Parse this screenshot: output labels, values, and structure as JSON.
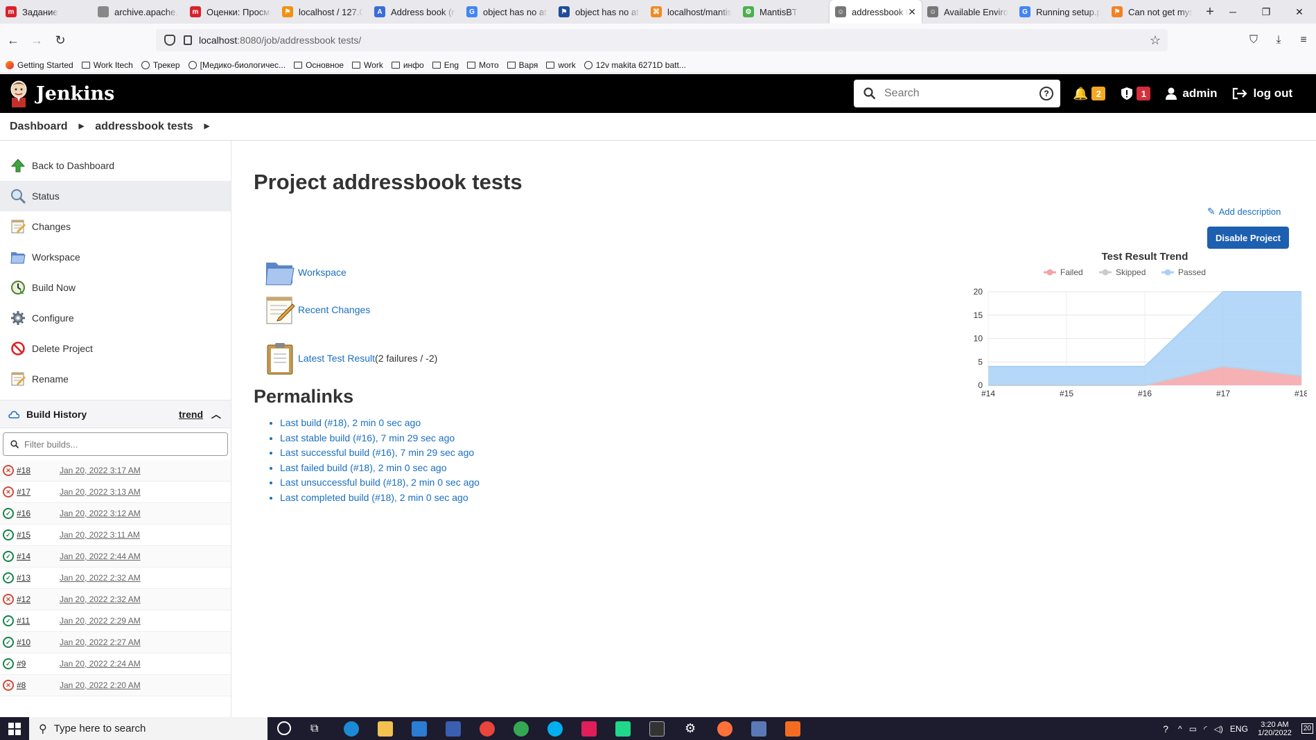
{
  "browser": {
    "tabs": [
      {
        "title": "Задание",
        "color": "#d7222b",
        "glyph": "m"
      },
      {
        "title": "archive.apache.org/c",
        "color": "#888",
        "glyph": ""
      },
      {
        "title": "Оценки: Просмо",
        "color": "#d7222b",
        "glyph": "m"
      },
      {
        "title": "localhost / 127.0",
        "color": "#f29111",
        "glyph": "⚑"
      },
      {
        "title": "Address book (n",
        "color": "#3a6ed6",
        "glyph": "A"
      },
      {
        "title": "object has no att",
        "color": "#4285f4",
        "glyph": "G"
      },
      {
        "title": "object has no att",
        "color": "#1f4c9a",
        "glyph": "⚑"
      },
      {
        "title": "localhost/mantis",
        "color": "#f08a24",
        "glyph": "⌘"
      },
      {
        "title": "MantisBT",
        "color": "#4caf50",
        "glyph": "⚙"
      },
      {
        "title": "addressbook t",
        "color": "#777",
        "glyph": "☺",
        "active": true
      },
      {
        "title": "Available Enviro",
        "color": "#777",
        "glyph": "☺"
      },
      {
        "title": "Running setup.p",
        "color": "#4285f4",
        "glyph": "G"
      },
      {
        "title": "Can not get mys",
        "color": "#f48024",
        "glyph": "⚑"
      }
    ],
    "url_host": "localhost",
    "url_rest": ":8080/job/addressbook tests/",
    "bookmarks": [
      {
        "label": "Getting Started",
        "icon": "firefox-icon"
      },
      {
        "label": "Work Itech",
        "icon": "folder-icon"
      },
      {
        "label": "Трекер",
        "icon": "globe-icon"
      },
      {
        "label": "[Медико-биологичес...",
        "icon": "globe-icon"
      },
      {
        "label": "Основное",
        "icon": "folder-icon"
      },
      {
        "label": "Work",
        "icon": "folder-icon"
      },
      {
        "label": "инфо",
        "icon": "folder-icon"
      },
      {
        "label": "Eng",
        "icon": "folder-icon"
      },
      {
        "label": "Мото",
        "icon": "folder-icon"
      },
      {
        "label": "Варя",
        "icon": "folder-icon"
      },
      {
        "label": "work",
        "icon": "folder-icon"
      },
      {
        "label": "12v makita 6271D batt...",
        "icon": "globe-icon"
      }
    ]
  },
  "header": {
    "brand": "Jenkins",
    "search_placeholder": "Search",
    "notifications": "2",
    "security": "1",
    "user": "admin",
    "logout": "log out",
    "colors": {
      "notif": "#f5a623",
      "security": "#d32f3c"
    }
  },
  "breadcrumb": {
    "root": "Dashboard",
    "current": "addressbook tests"
  },
  "sidebar": {
    "tasks": [
      {
        "label": "Back to Dashboard",
        "icon": "up-arrow-icon"
      },
      {
        "label": "Status",
        "icon": "magnifier-icon",
        "active": true
      },
      {
        "label": "Changes",
        "icon": "notepad-icon"
      },
      {
        "label": "Workspace",
        "icon": "folder-icon"
      },
      {
        "label": "Build Now",
        "icon": "clock-icon"
      },
      {
        "label": "Configure",
        "icon": "gear-icon"
      },
      {
        "label": "Delete Project",
        "icon": "no-entry-icon"
      },
      {
        "label": "Rename",
        "icon": "notepad-icon"
      }
    ],
    "build_history": {
      "title": "Build History",
      "trend": "trend",
      "filter_placeholder": "Filter builds...",
      "builds": [
        {
          "num": "#18",
          "date": "Jan 20, 2022 3:17 AM",
          "status": "failed"
        },
        {
          "num": "#17",
          "date": "Jan 20, 2022 3:13 AM",
          "status": "failed"
        },
        {
          "num": "#16",
          "date": "Jan 20, 2022 3:12 AM",
          "status": "success"
        },
        {
          "num": "#15",
          "date": "Jan 20, 2022 3:11 AM",
          "status": "success"
        },
        {
          "num": "#14",
          "date": "Jan 20, 2022 2:44 AM",
          "status": "success"
        },
        {
          "num": "#13",
          "date": "Jan 20, 2022 2:32 AM",
          "status": "success"
        },
        {
          "num": "#12",
          "date": "Jan 20, 2022 2:32 AM",
          "status": "failed"
        },
        {
          "num": "#11",
          "date": "Jan 20, 2022 2:29 AM",
          "status": "success"
        },
        {
          "num": "#10",
          "date": "Jan 20, 2022 2:27 AM",
          "status": "success"
        },
        {
          "num": "#9",
          "date": "Jan 20, 2022 2:24 AM",
          "status": "success"
        },
        {
          "num": "#8",
          "date": "Jan 20, 2022 2:20 AM",
          "status": "failed"
        }
      ]
    }
  },
  "main": {
    "title": "Project addressbook tests",
    "add_description": "Add description",
    "disable_button": "Disable Project",
    "links": {
      "workspace": "Workspace",
      "recent_changes": "Recent Changes",
      "latest_test": "Latest Test Result",
      "latest_test_suffix": " (2 failures / -2)"
    },
    "permalinks_title": "Permalinks",
    "permalinks": [
      "Last build (#18), 2 min 0 sec ago",
      "Last stable build (#16), 7 min 29 sec ago",
      "Last successful build (#16), 7 min 29 sec ago",
      "Last failed build (#18), 2 min 0 sec ago",
      "Last unsuccessful build (#18), 2 min 0 sec ago",
      "Last completed build (#18), 2 min 0 sec ago"
    ]
  },
  "chart_data": {
    "type": "area",
    "title": "Test Result Trend",
    "categories": [
      "#14",
      "#15",
      "#16",
      "#17",
      "#18"
    ],
    "series": [
      {
        "name": "Failed",
        "values": [
          0,
          0,
          0,
          4,
          2
        ],
        "color": "#f4a3a8"
      },
      {
        "name": "Skipped",
        "values": [
          0,
          0,
          0,
          0,
          0
        ],
        "color": "#cccccc"
      },
      {
        "name": "Passed",
        "values": [
          4,
          4,
          4,
          16,
          18
        ],
        "color": "#a9d1f7"
      }
    ],
    "ylim": [
      0,
      20
    ],
    "yticks": [
      0,
      5,
      10,
      15,
      20
    ],
    "legend": "top"
  },
  "taskbar": {
    "search_placeholder": "Type here to search",
    "lang": "ENG",
    "time": "3:20 AM",
    "date": "1/20/2022",
    "notif_count": "20"
  }
}
